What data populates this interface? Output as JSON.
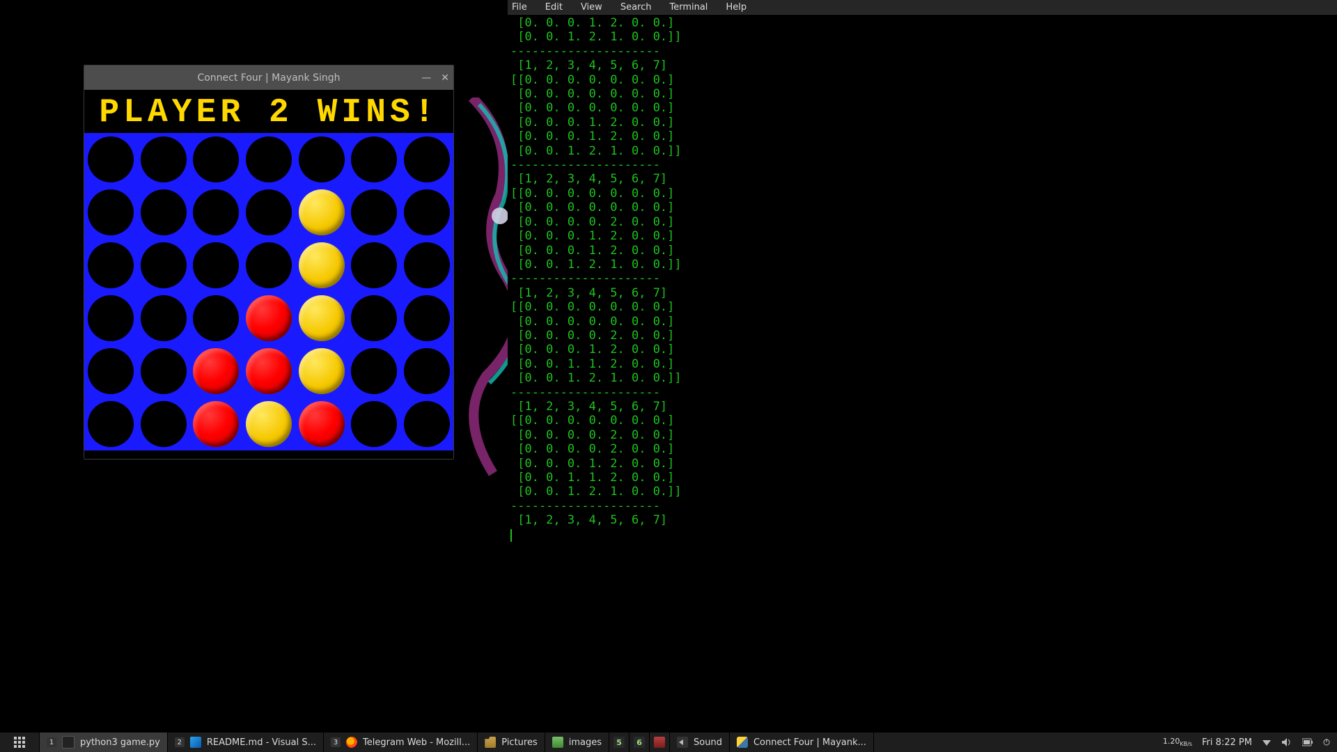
{
  "game": {
    "window_title": "Connect Four | Mayank Singh",
    "status_text": "PLAYER 2 WINS!",
    "rows": 6,
    "cols": 7,
    "board": [
      [
        0,
        0,
        0,
        0,
        0,
        0,
        0
      ],
      [
        0,
        0,
        0,
        0,
        2,
        0,
        0
      ],
      [
        0,
        0,
        0,
        0,
        2,
        0,
        0
      ],
      [
        0,
        0,
        0,
        1,
        2,
        0,
        0
      ],
      [
        0,
        0,
        1,
        1,
        2,
        0,
        0
      ],
      [
        0,
        0,
        1,
        2,
        1,
        0,
        0
      ]
    ],
    "colors": {
      "board": "#1a1aff",
      "p1": "#ff0000",
      "p2": "#f5c800",
      "empty": "#000000"
    }
  },
  "terminal": {
    "menu": [
      "File",
      "Edit",
      "View",
      "Search",
      "Terminal",
      "Help"
    ],
    "lines": [
      " [0. 0. 0. 1. 2. 0. 0.]",
      " [0. 0. 1. 2. 1. 0. 0.]]",
      "---------------------",
      " [1, 2, 3, 4, 5, 6, 7]",
      "[[0. 0. 0. 0. 0. 0. 0.]",
      " [0. 0. 0. 0. 0. 0. 0.]",
      " [0. 0. 0. 0. 0. 0. 0.]",
      " [0. 0. 0. 1. 2. 0. 0.]",
      " [0. 0. 0. 1. 2. 0. 0.]",
      " [0. 0. 1. 2. 1. 0. 0.]]",
      "---------------------",
      " [1, 2, 3, 4, 5, 6, 7]",
      "[[0. 0. 0. 0. 0. 0. 0.]",
      " [0. 0. 0. 0. 0. 0. 0.]",
      " [0. 0. 0. 0. 2. 0. 0.]",
      " [0. 0. 0. 1. 2. 0. 0.]",
      " [0. 0. 0. 1. 2. 0. 0.]",
      " [0. 0. 1. 2. 1. 0. 0.]]",
      "---------------------",
      " [1, 2, 3, 4, 5, 6, 7]",
      "[[0. 0. 0. 0. 0. 0. 0.]",
      " [0. 0. 0. 0. 0. 0. 0.]",
      " [0. 0. 0. 0. 2. 0. 0.]",
      " [0. 0. 0. 1. 2. 0. 0.]",
      " [0. 0. 1. 1. 2. 0. 0.]",
      " [0. 0. 1. 2. 1. 0. 0.]]",
      "---------------------",
      " [1, 2, 3, 4, 5, 6, 7]",
      "[[0. 0. 0. 0. 0. 0. 0.]",
      " [0. 0. 0. 0. 2. 0. 0.]",
      " [0. 0. 0. 0. 2. 0. 0.]",
      " [0. 0. 0. 1. 2. 0. 0.]",
      " [0. 0. 1. 1. 2. 0. 0.]",
      " [0. 0. 1. 2. 1. 0. 0.]]",
      "---------------------",
      " [1, 2, 3, 4, 5, 6, 7]"
    ]
  },
  "taskbar": {
    "workspace": "1",
    "items": [
      {
        "label": "python3 game.py",
        "icon": "term"
      },
      {
        "label": "README.md - Visual S...",
        "icon": "vsc"
      },
      {
        "label": "Telegram Web - Mozill...",
        "icon": "ff"
      },
      {
        "label": "Pictures",
        "icon": "folder"
      },
      {
        "label": "images",
        "icon": "img"
      },
      {
        "label": "",
        "icon": "num5"
      },
      {
        "label": "",
        "icon": "num6"
      },
      {
        "label": "",
        "icon": "wine"
      },
      {
        "label": "Sound",
        "icon": "sound"
      },
      {
        "label": "Connect Four | Mayank...",
        "icon": "py"
      }
    ],
    "net": {
      "value": "1.20",
      "unit": "KB/s"
    },
    "clock": "Fri  8:22 PM"
  }
}
